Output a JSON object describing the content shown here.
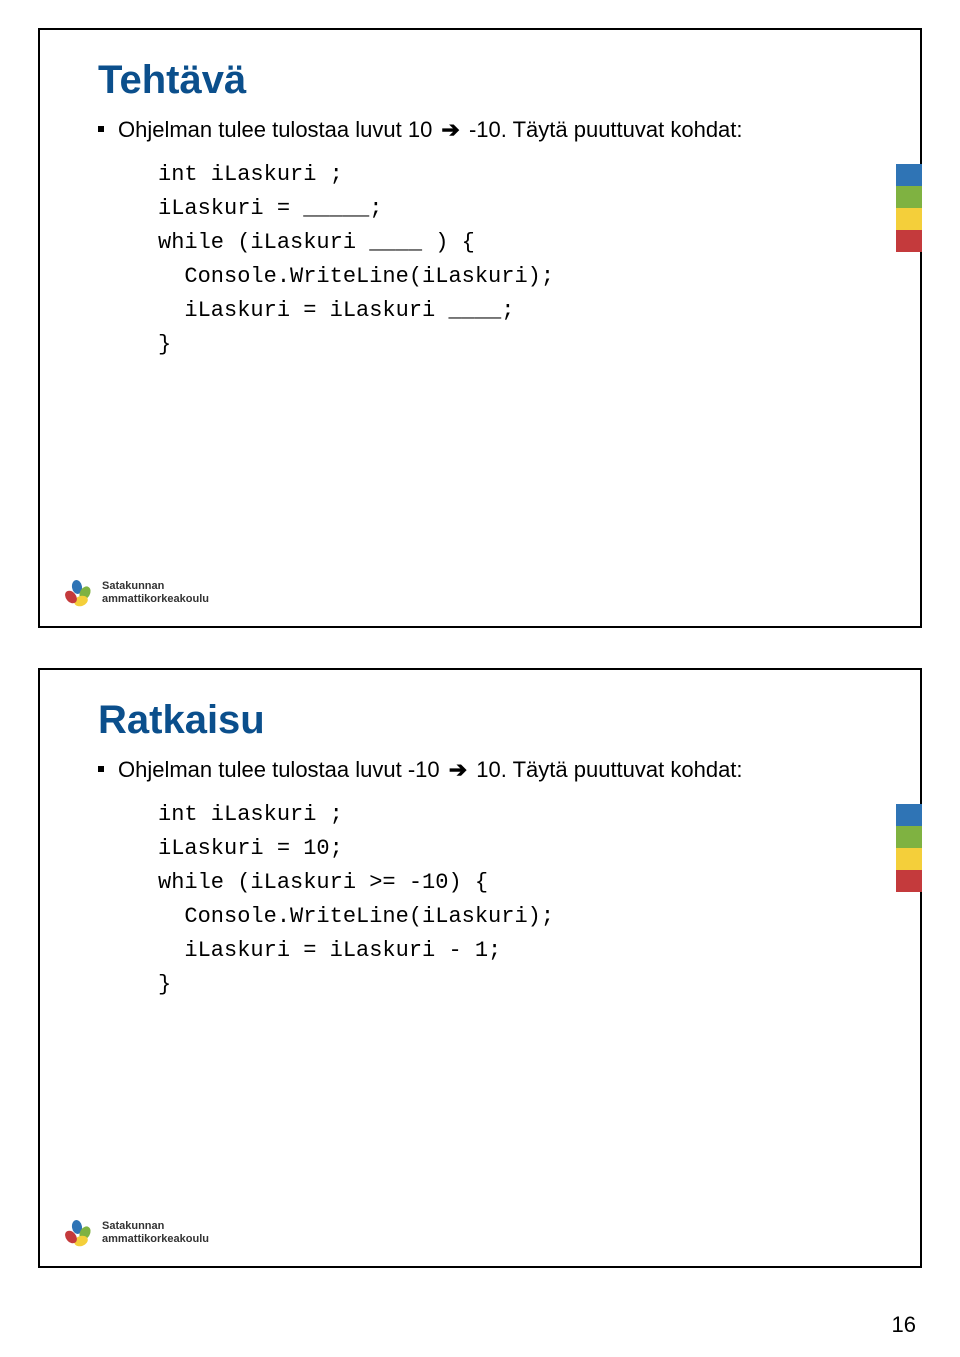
{
  "page_number": "16",
  "slide1": {
    "title": "Tehtävä",
    "bullet_prefix": "Ohjelman tulee tulostaa luvut 10 ",
    "bullet_suffix": " -10. Täytä puuttuvat kohdat:",
    "arrow": "➔",
    "code": "int iLaskuri ;\niLaskuri = _____;\nwhile (iLaskuri ____ ) {\n  Console.WriteLine(iLaskuri);\n  iLaskuri = iLaskuri ____;\n}",
    "logo_line1": "Satakunnan",
    "logo_line2": "ammattikorkeakoulu"
  },
  "slide2": {
    "title": "Ratkaisu",
    "bullet_prefix": "Ohjelman tulee tulostaa luvut -10 ",
    "bullet_suffix": " 10. Täytä puuttuvat kohdat:",
    "arrow": "➔",
    "code": "int iLaskuri ;\niLaskuri = 10;\nwhile (iLaskuri >= -10) {\n  Console.WriteLine(iLaskuri);\n  iLaskuri = iLaskuri - 1;\n}",
    "logo_line1": "Satakunnan",
    "logo_line2": "ammattikorkeakoulu"
  }
}
